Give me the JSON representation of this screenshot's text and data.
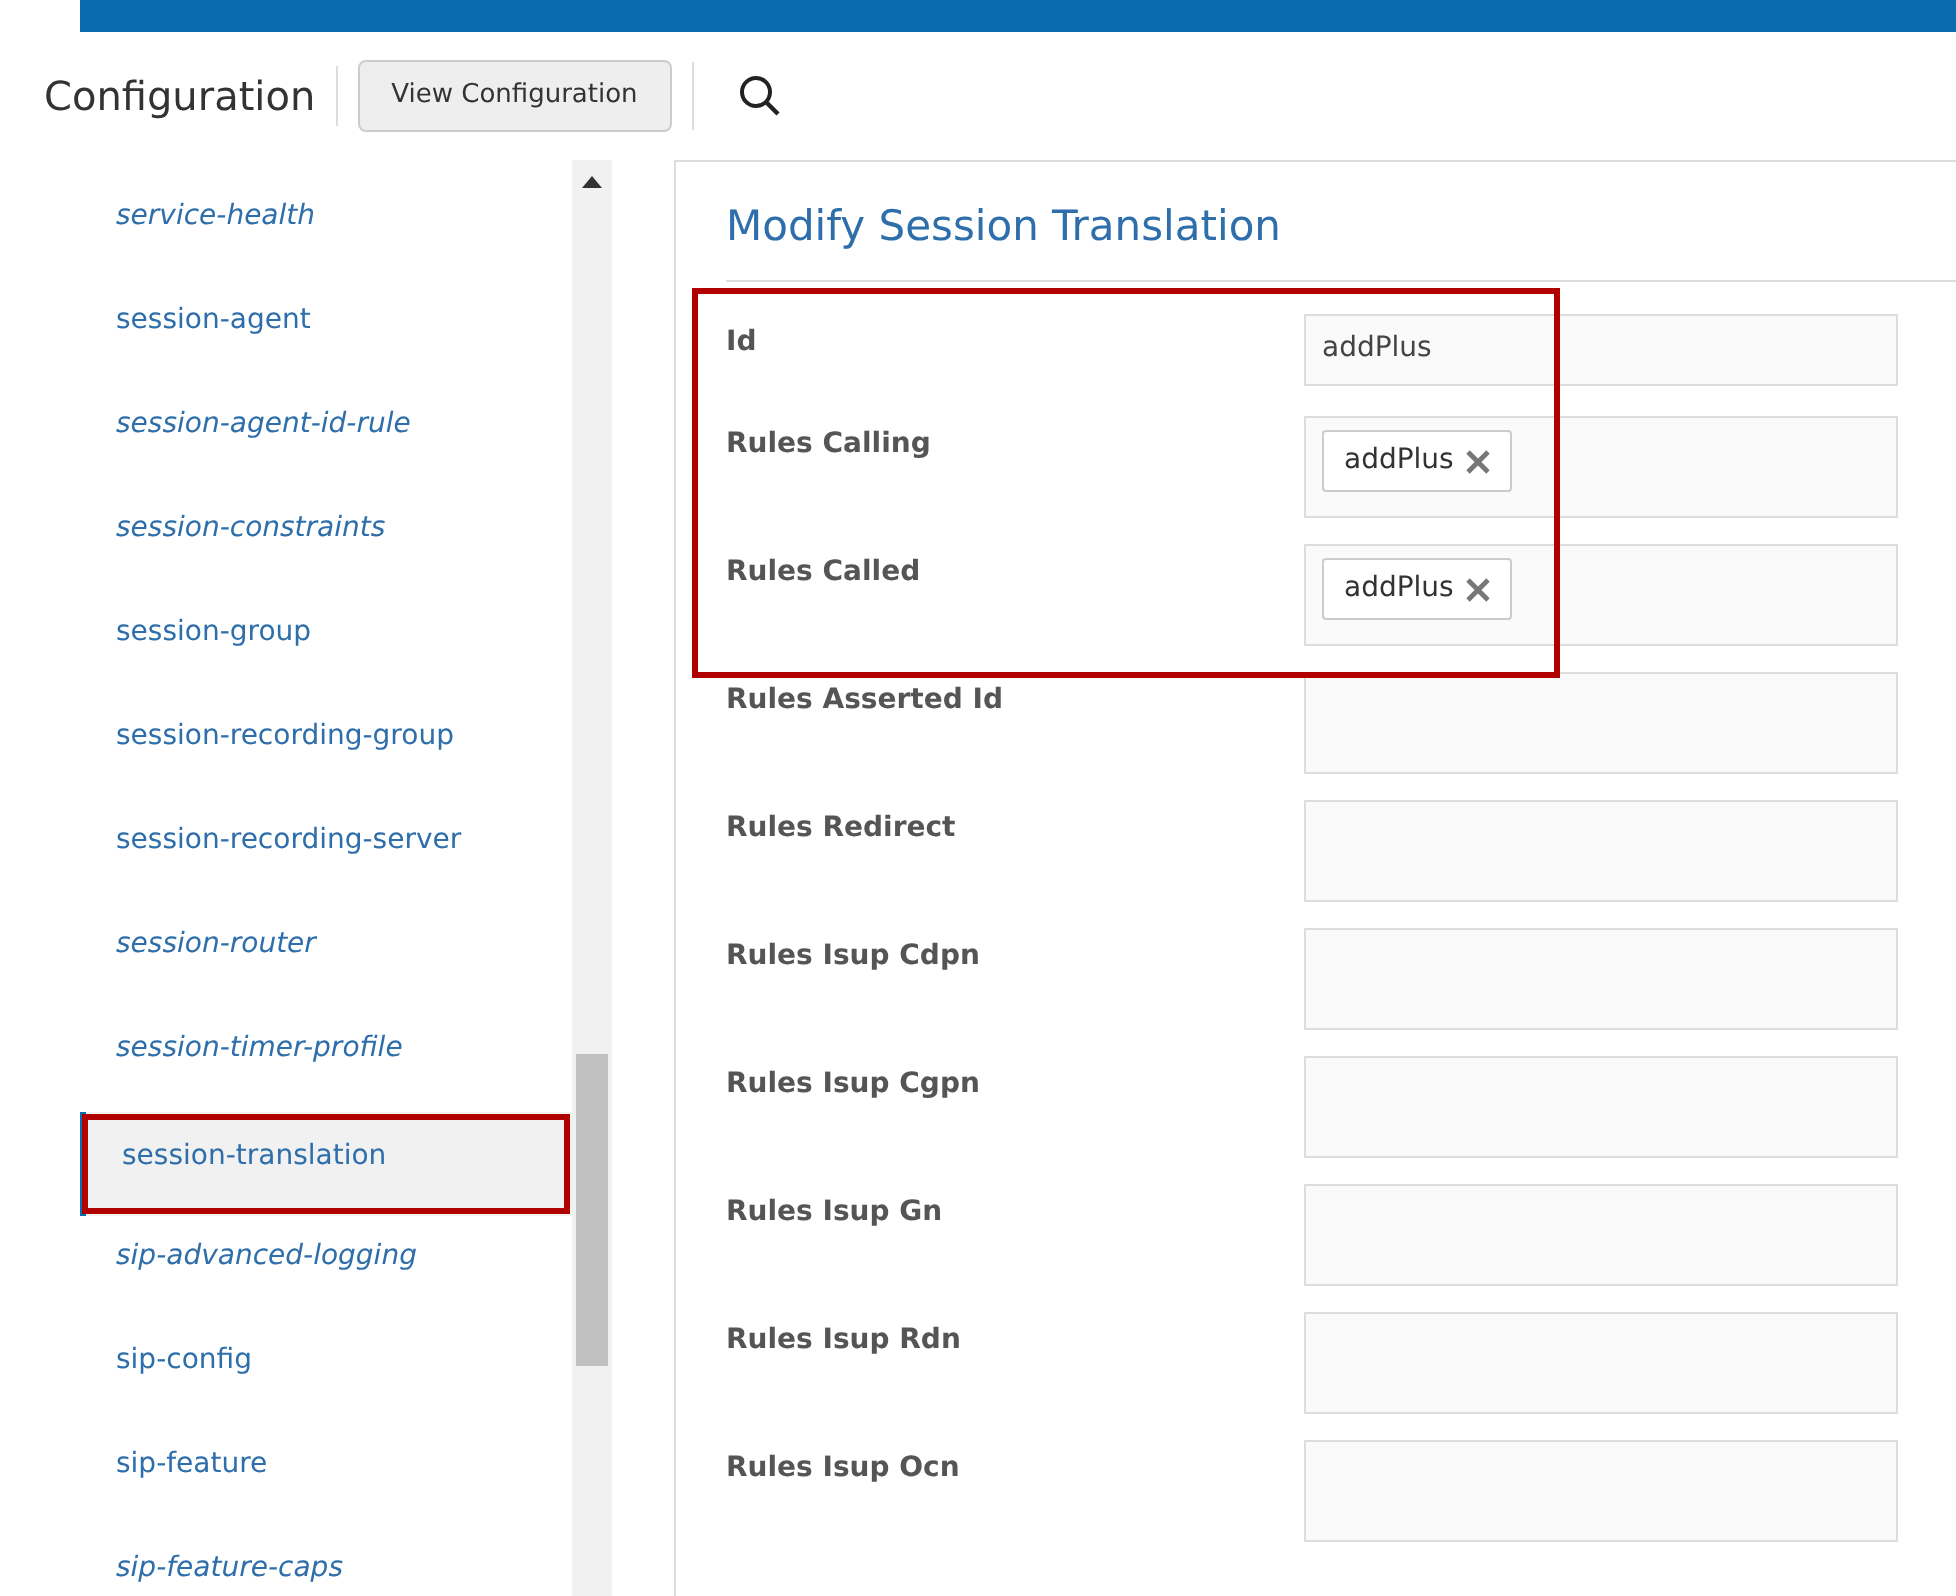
{
  "header": {
    "title": "Configuration",
    "view_button": "View Configuration"
  },
  "sidebar": {
    "items": [
      {
        "label": "service-health",
        "italic": true,
        "selected": false
      },
      {
        "label": "session-agent",
        "italic": false,
        "selected": false
      },
      {
        "label": "session-agent-id-rule",
        "italic": true,
        "selected": false
      },
      {
        "label": "session-constraints",
        "italic": true,
        "selected": false
      },
      {
        "label": "session-group",
        "italic": false,
        "selected": false
      },
      {
        "label": "session-recording-group",
        "italic": false,
        "selected": false
      },
      {
        "label": "session-recording-server",
        "italic": false,
        "selected": false
      },
      {
        "label": "session-router",
        "italic": true,
        "selected": false
      },
      {
        "label": "session-timer-profile",
        "italic": true,
        "selected": false
      },
      {
        "label": "session-translation",
        "italic": false,
        "selected": true
      },
      {
        "label": "sip-advanced-logging",
        "italic": true,
        "selected": false
      },
      {
        "label": "sip-config",
        "italic": false,
        "selected": false
      },
      {
        "label": "sip-feature",
        "italic": false,
        "selected": false
      },
      {
        "label": "sip-feature-caps",
        "italic": true,
        "selected": false
      }
    ]
  },
  "form": {
    "title": "Modify Session Translation",
    "fields": [
      {
        "label": "Id",
        "kind": "text",
        "value": "addPlus",
        "highlighted": true
      },
      {
        "label": "Rules Calling",
        "kind": "tags",
        "tags": [
          "addPlus"
        ],
        "highlighted": true
      },
      {
        "label": "Rules Called",
        "kind": "tags",
        "tags": [
          "addPlus"
        ],
        "highlighted": true
      },
      {
        "label": "Rules Asserted Id",
        "kind": "tags",
        "highlighted": false
      },
      {
        "label": "Rules Redirect",
        "kind": "tags",
        "highlighted": false
      },
      {
        "label": "Rules Isup Cdpn",
        "kind": "tags",
        "highlighted": false
      },
      {
        "label": "Rules Isup Cgpn",
        "kind": "tags",
        "highlighted": false
      },
      {
        "label": "Rules Isup Gn",
        "kind": "tags",
        "highlighted": false
      },
      {
        "label": "Rules Isup Rdn",
        "kind": "tags",
        "highlighted": false
      },
      {
        "label": "Rules Isup Ocn",
        "kind": "tags",
        "highlighted": false
      }
    ]
  }
}
